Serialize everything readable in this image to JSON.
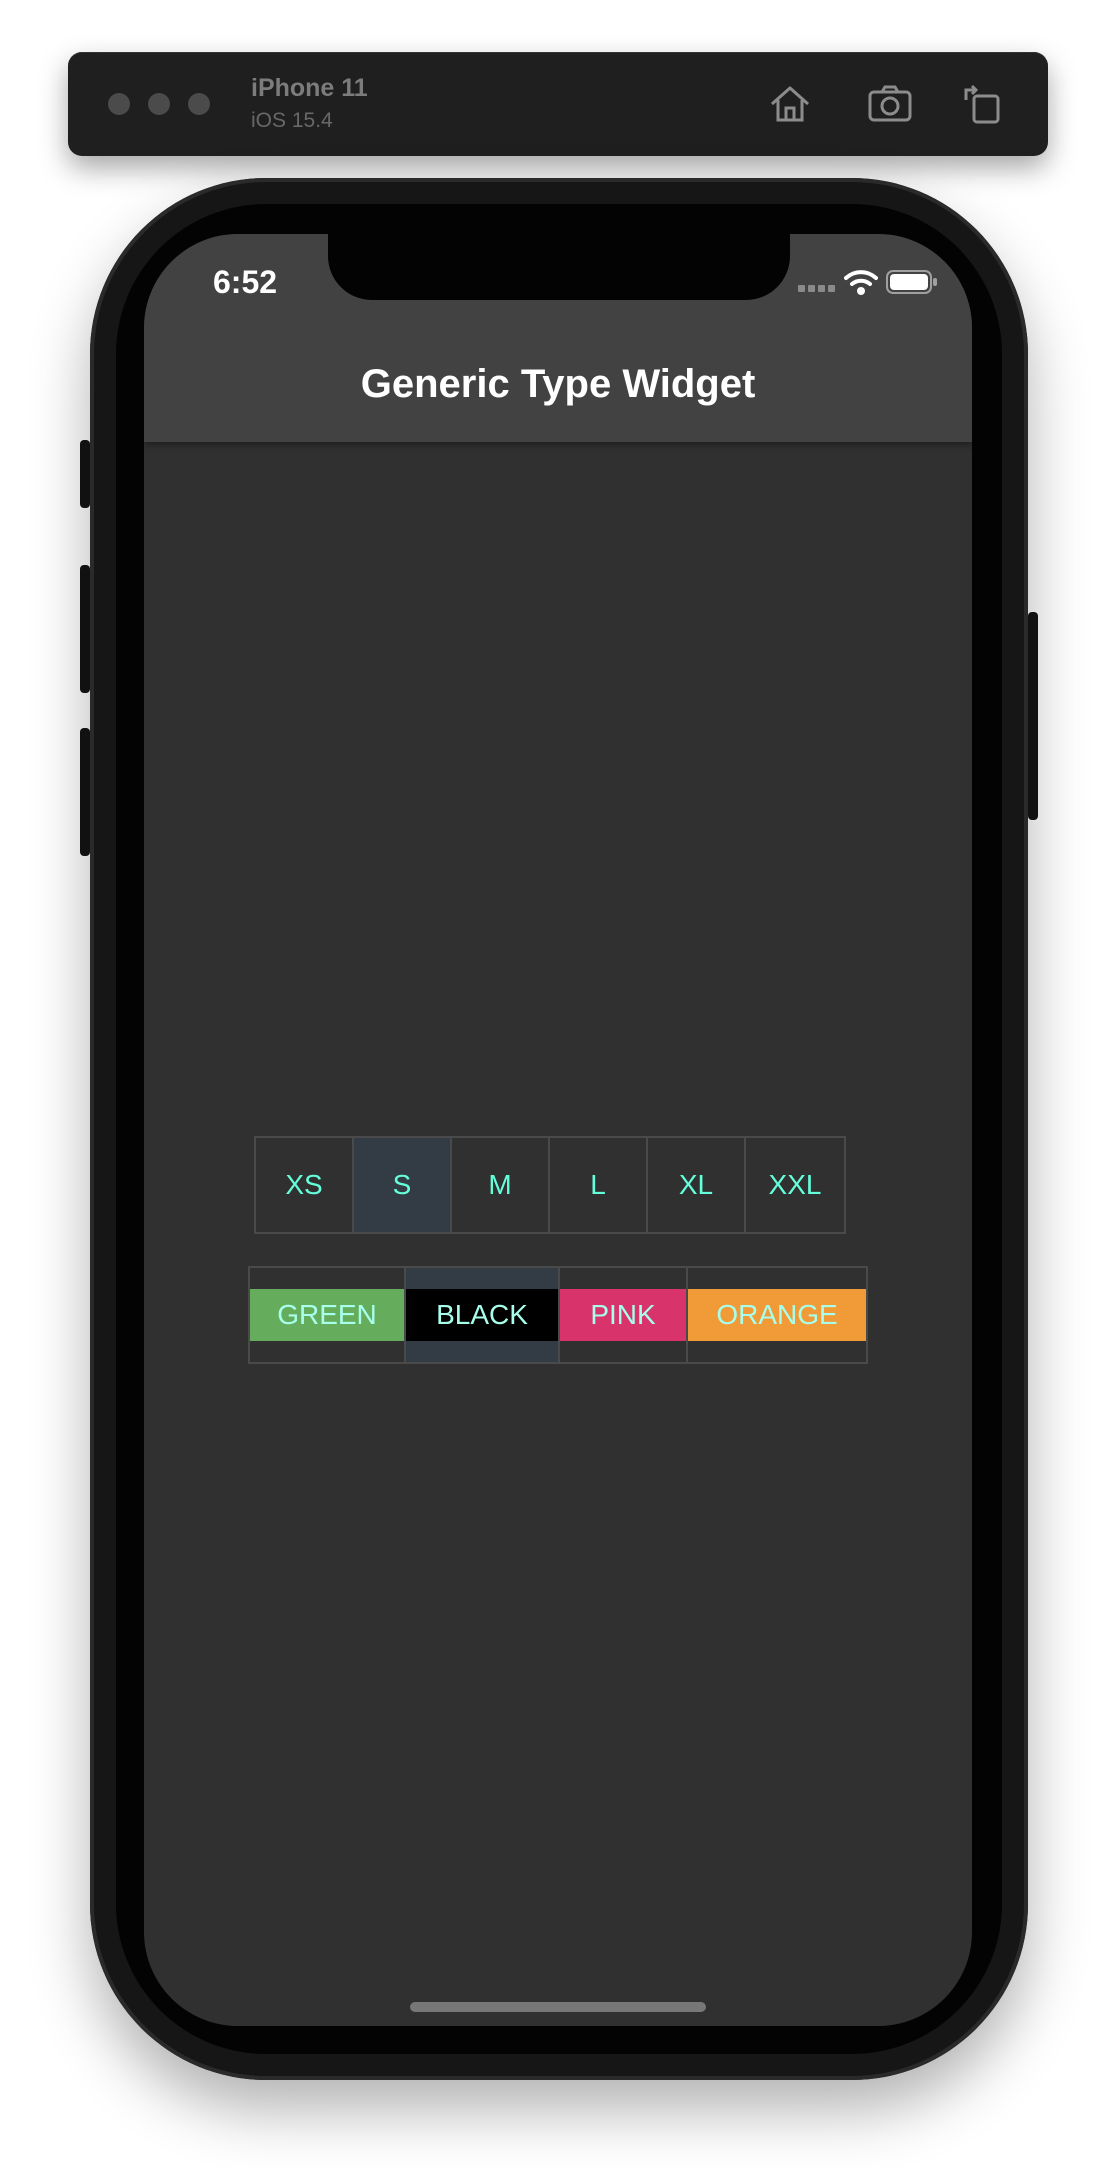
{
  "simulator": {
    "device_name": "iPhone 11",
    "os_version": "iOS 15.4",
    "toolbar_icons": [
      "home-icon",
      "screenshot-icon",
      "rotate-icon"
    ]
  },
  "status_bar": {
    "time": "6:52",
    "icons": [
      "cellular-icon",
      "wifi-icon",
      "battery-icon"
    ]
  },
  "app_bar": {
    "title": "Generic Type Widget"
  },
  "sizes": {
    "options": [
      "XS",
      "S",
      "M",
      "L",
      "XL",
      "XXL"
    ],
    "selected": "S",
    "text_color": "#64ffda"
  },
  "colors": {
    "options": [
      {
        "label": "GREEN",
        "color": "#65ad5c"
      },
      {
        "label": "BLACK",
        "color": "#000000"
      },
      {
        "label": "PINK",
        "color": "#d8336a"
      },
      {
        "label": "ORANGE",
        "color": "#f09a38"
      }
    ],
    "selected": "BLACK",
    "text_color": "#a7ffeb"
  }
}
